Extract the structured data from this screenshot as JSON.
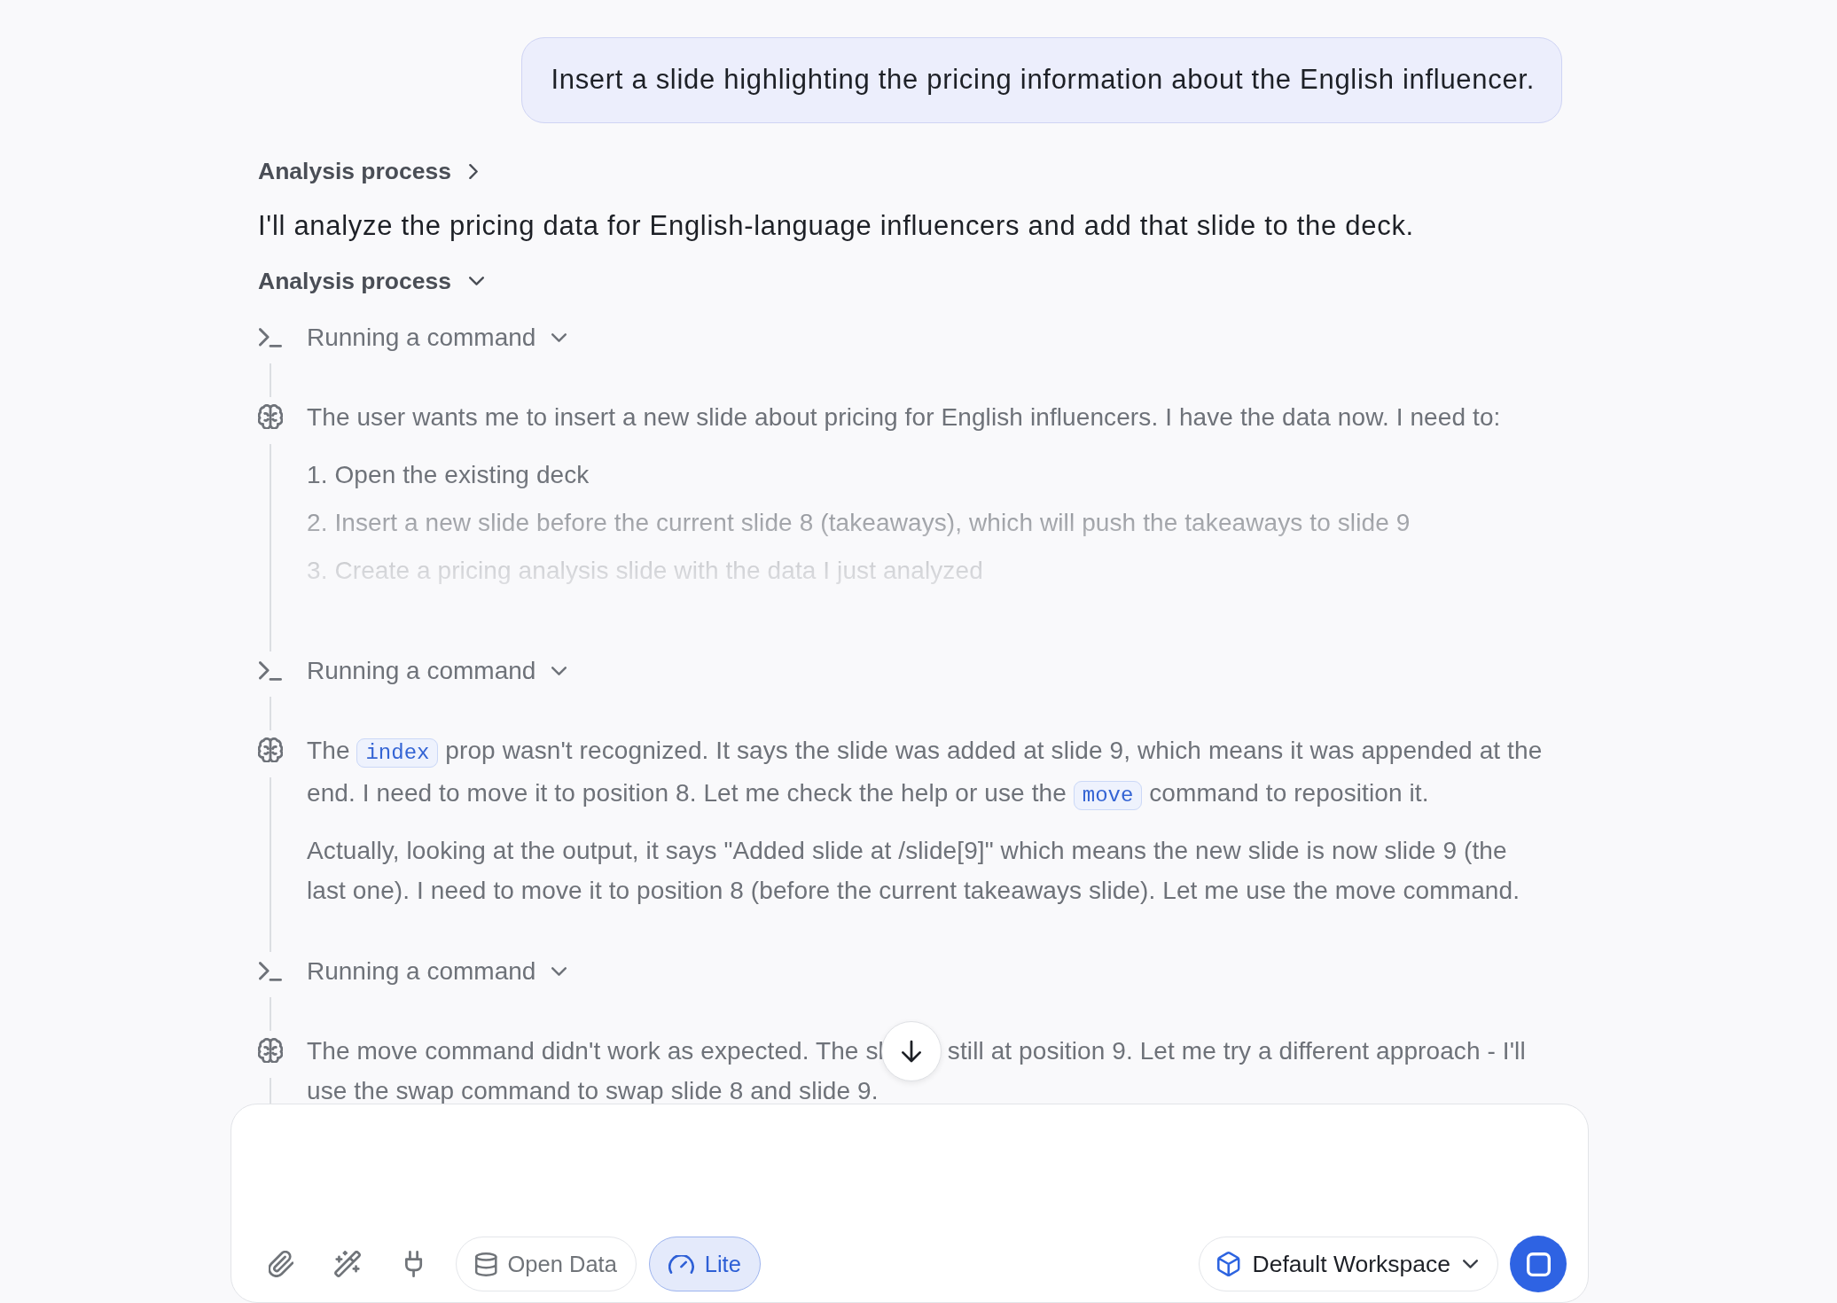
{
  "user_message": {
    "text": "Insert a slide highlighting the pricing information about the English influencer."
  },
  "thread": [
    {
      "kind": "process",
      "label": "Analysis process",
      "expanded": false
    },
    {
      "kind": "reply",
      "text": "I'll analyze the pricing data for English-language influencers and add that slide to the deck."
    },
    {
      "kind": "process",
      "label": "Analysis process",
      "expanded": true,
      "steps": [
        {
          "kind": "command",
          "label": "Running a command"
        },
        {
          "kind": "thought",
          "truncated": true,
          "paragraphs": [
            {
              "segments": [
                {
                  "kind": "text",
                  "text": "The user wants me to insert a new slide about pricing for English influencers. I have the data now. I need to:"
                }
              ]
            }
          ],
          "list": [
            "1. Open the existing deck",
            "2. Insert a new slide before the current slide 8 (takeaways), which will push the takeaways to slide 9",
            "3. Create a pricing analysis slide with the data I just analyzed"
          ]
        },
        {
          "kind": "command",
          "label": "Running a command"
        },
        {
          "kind": "thought",
          "paragraphs": [
            {
              "segments": [
                {
                  "kind": "text",
                  "text": "The "
                },
                {
                  "kind": "code",
                  "text": "index"
                },
                {
                  "kind": "text",
                  "text": " prop wasn't recognized. It says the slide was added at slide 9, which means it was appended at the end. I need to move it to position 8. Let me check the help or use the "
                },
                {
                  "kind": "code",
                  "text": "move"
                },
                {
                  "kind": "text",
                  "text": " command to reposition it."
                }
              ]
            },
            {
              "segments": [
                {
                  "kind": "text",
                  "text": "Actually, looking at the output, it says \"Added slide at /slide[9]\" which means the new slide is now slide 9 (the last one). I need to move it to position 8 (before the current takeaways slide). Let me use the move command."
                }
              ]
            }
          ]
        },
        {
          "kind": "command",
          "label": "Running a command"
        },
        {
          "kind": "thought",
          "paragraphs": [
            {
              "segments": [
                {
                  "kind": "text",
                  "text": "The move command didn't work as expected. The sl"
                },
                {
                  "kind": "scroll_button"
                },
                {
                  "kind": "text",
                  "text": "still at position 9. Let me try a different approach - I'll"
                },
                {
                  "kind": "text",
                  "text": "use the swap command to swap slide 8 and slide 9."
                }
              ]
            }
          ]
        }
      ]
    }
  ],
  "composer": {
    "toggles": [
      {
        "kind": "data",
        "label": "Open Data",
        "selected": false
      },
      {
        "kind": "speed",
        "label": "Lite",
        "selected": true
      }
    ],
    "workspace": {
      "label": "Default Workspace"
    }
  }
}
